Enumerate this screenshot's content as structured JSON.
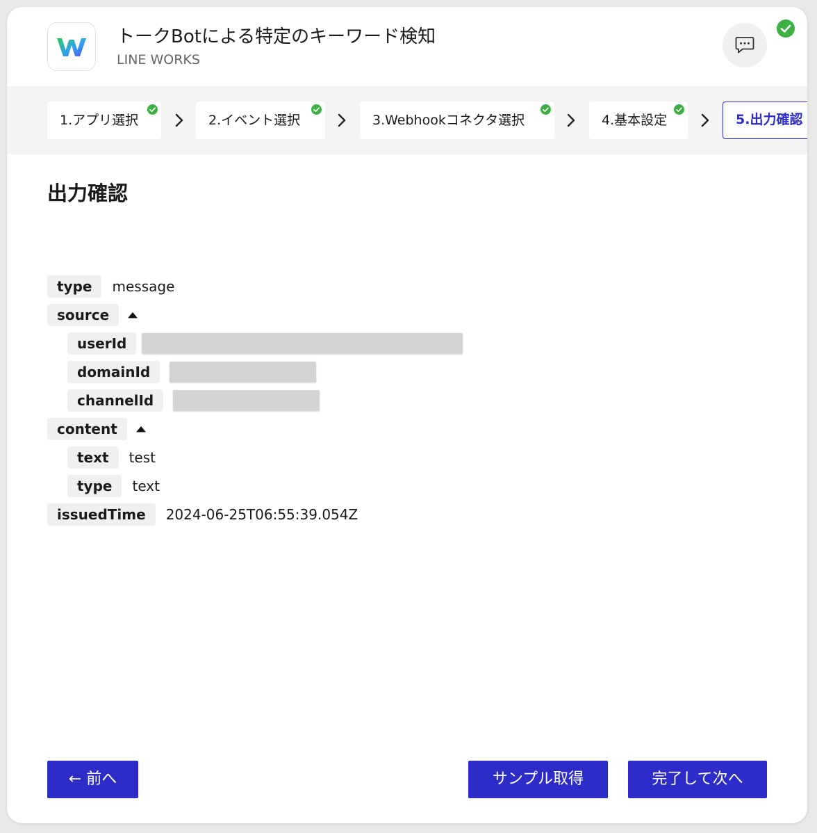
{
  "header": {
    "title": "トークBotによる特定のキーワード検知",
    "subtitle": "LINE WORKS",
    "app_icon": "line-works-logo",
    "chat_icon": "chat-bubble-icon",
    "status_icon": "check-circle-icon"
  },
  "stepper": {
    "steps": [
      {
        "label": "1.アプリ選択",
        "done": true
      },
      {
        "label": "2.イベント選択",
        "done": true
      },
      {
        "label": "3.Webhookコネクタ選択",
        "done": true
      },
      {
        "label": "4.基本設定",
        "done": true
      },
      {
        "label": "5.出力確認",
        "done": false,
        "active": true
      }
    ]
  },
  "section_title": "出力確認",
  "output": {
    "type": {
      "key": "type",
      "value": "message"
    },
    "source": {
      "key": "source",
      "userId": {
        "key": "userId",
        "value_masked": true
      },
      "domainId": {
        "key": "domainId",
        "value_masked": true
      },
      "channelId": {
        "key": "channelId",
        "value_masked": true
      }
    },
    "content": {
      "key": "content",
      "text": {
        "key": "text",
        "value": "test"
      },
      "type": {
        "key": "type",
        "value": "text"
      }
    },
    "issuedTime": {
      "key": "issuedTime",
      "value": "2024-06-25T06:55:39.054Z"
    }
  },
  "buttons": {
    "back": "← 前へ",
    "sample": "サンプル取得",
    "complete": "完了して次へ"
  },
  "colors": {
    "accent": "#2d2cc9",
    "success": "#3cb043",
    "key_bg": "#f0f0f0",
    "masked": "#d4d4d4"
  }
}
